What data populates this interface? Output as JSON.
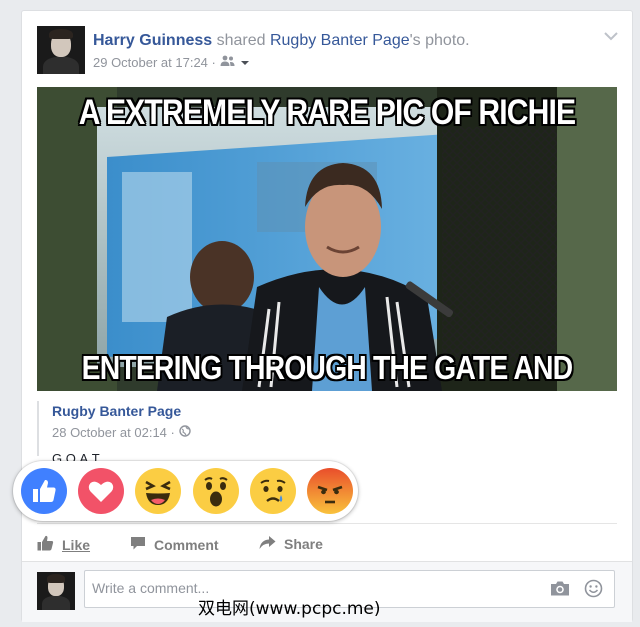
{
  "post": {
    "author": "Harry Guinness",
    "action_text": " shared ",
    "page_name": "Rugby Banter Page",
    "photo_suffix": "'s photo.",
    "timestamp": "29 October at 17:24 ·",
    "audience_icon": "friends-icon",
    "menu_icon": "chevron-down-icon"
  },
  "photo": {
    "top_text": "A EXTREMELY RARE PIC OF RICHIE",
    "bottom_text": "ENTERING THROUGH THE GATE AND ON HIS FEET"
  },
  "shared_post": {
    "page_name": "Rugby Banter Page",
    "timestamp": "28 October at 02:14 ·",
    "caption": "G.O.A.T."
  },
  "reactions": [
    {
      "name": "Like",
      "icon": "like-reaction-icon",
      "color": "#4080ff"
    },
    {
      "name": "Love",
      "icon": "love-reaction-icon",
      "color": "#f25268"
    },
    {
      "name": "Haha",
      "icon": "haha-reaction-icon",
      "color": "#fbcd43"
    },
    {
      "name": "Wow",
      "icon": "wow-reaction-icon",
      "color": "#fbcd43"
    },
    {
      "name": "Sad",
      "icon": "sad-reaction-icon",
      "color": "#fbcd43"
    },
    {
      "name": "Angry",
      "icon": "angry-reaction-icon",
      "color": "#f15a34"
    }
  ],
  "actions": {
    "like": "Like",
    "comment": "Comment",
    "share": "Share"
  },
  "comment_box": {
    "placeholder": "Write a comment...",
    "camera_icon": "camera-icon",
    "emoji_icon": "emoji-icon"
  },
  "watermark": "双电网(www.pcpc.me)",
  "colors": {
    "link": "#365899",
    "meta": "#90949c",
    "background": "#e9ebee"
  }
}
